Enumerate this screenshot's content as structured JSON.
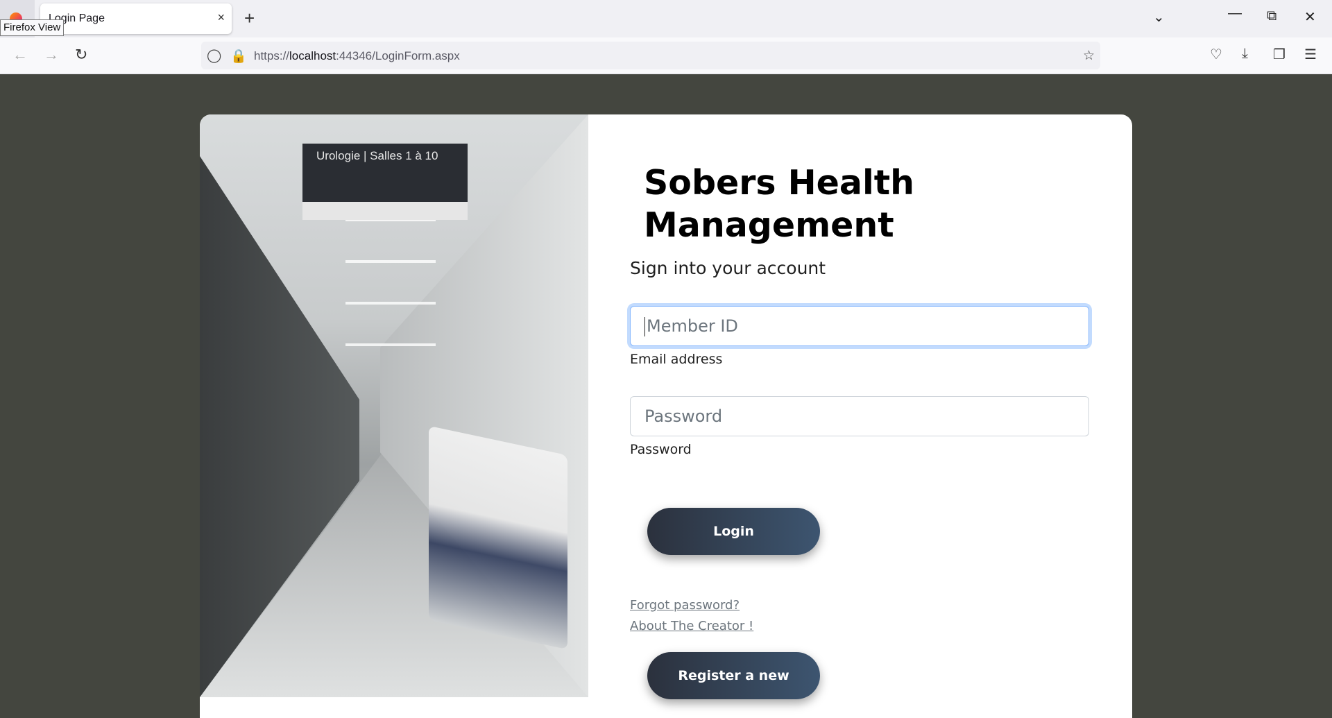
{
  "browser": {
    "tooltip": "Firefox View",
    "tab_title": "Login Page",
    "tab_close": "×",
    "new_tab": "+",
    "url_host_prefix": "https://",
    "url_host": "localhost",
    "url_rest": ":44346/LoginForm.aspx",
    "icons": [
      "firefox-view-icon",
      "back-icon",
      "forward-icon",
      "reload-icon",
      "shield-icon",
      "lock-icon",
      "bookmark-star-icon",
      "pocket-icon",
      "download-icon",
      "extensions-icon",
      "menu-icon",
      "list-all-tabs-icon",
      "minimize-icon",
      "restore-icon",
      "close-window-icon"
    ]
  },
  "photo": {
    "sign_text": "Urologie | Salles 1 à 10"
  },
  "login": {
    "title": "Sobers Health Management",
    "subtitle": "Sign into your account",
    "member_placeholder": "Member ID",
    "member_label": "Email address",
    "password_placeholder": "Password",
    "password_label": "Password",
    "login_button": "Login",
    "forgot_link": "Forgot password?",
    "about_link": "About The Creator !",
    "register_button": "Register a new Account"
  },
  "colors": {
    "page_background": "#44463f",
    "button_gradient_start": "#2b313d",
    "button_gradient_end": "#3d5570",
    "focus_ring": "#86b7fe"
  }
}
